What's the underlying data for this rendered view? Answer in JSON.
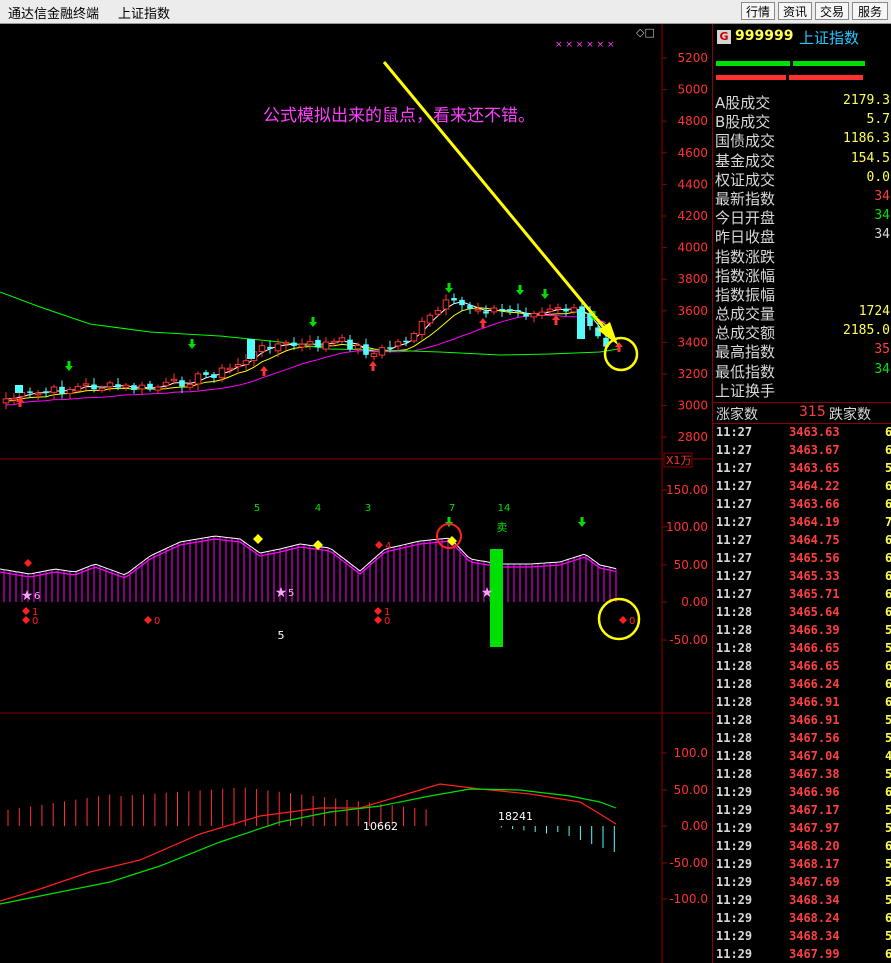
{
  "window": {
    "app_title": "通达信金融终端",
    "index_title": "上证指数"
  },
  "toolbar": [
    {
      "label": "行情"
    },
    {
      "label": "资讯"
    },
    {
      "label": "交易"
    },
    {
      "label": "服务"
    }
  ],
  "annotation": {
    "text": "公式模拟出来的鼠点，看来还不错。"
  },
  "colors": {
    "background": "#000000",
    "up": "#ff3232",
    "down": "#54fcfc",
    "ma_fast": "#ffffff",
    "ma_mid": "#ffff00",
    "ma_slow": "#ff00ff",
    "ma_long": "#00ff00",
    "arrow": "#ffff00",
    "grid": "#8b0000"
  },
  "main_chart": {
    "price_axis": [
      "5200",
      "5000",
      "4800",
      "4600",
      "4400",
      "4200",
      "4000",
      "3800",
      "3600",
      "3400",
      "3200",
      "3000",
      "2800"
    ],
    "corner_glyphs": "◇□",
    "stars": "× × × × × ×"
  },
  "indicator1": {
    "multiplier_tag": "X1万",
    "axis": [
      "150.00",
      "100.00",
      "50.00",
      "0.00",
      "-50.00"
    ],
    "top_numbers": [
      "5",
      "4",
      "3",
      "7",
      "14"
    ],
    "sell_label": "卖",
    "star_labels": [
      "6",
      "5"
    ],
    "diamond_labels": [
      "1",
      "0",
      "0",
      "4",
      "1",
      "0",
      "0"
    ],
    "bottom_number": "5"
  },
  "indicator2": {
    "axis": [
      "100.0",
      "50.00",
      "0.00",
      "-50.00",
      "-100.0"
    ],
    "labels": [
      "10662",
      "18241"
    ]
  },
  "quote": {
    "logo": "G",
    "code": "999999",
    "name": "上证指数",
    "stats": [
      {
        "label": "A股成交",
        "value": "2179.3",
        "color": "y"
      },
      {
        "label": "B股成交",
        "value": "5.7",
        "color": "y"
      },
      {
        "label": "国债成交",
        "value": "1186.3",
        "color": "y"
      },
      {
        "label": "基金成交",
        "value": "154.5",
        "color": "y"
      },
      {
        "label": "权证成交",
        "value": "0.0",
        "color": "y"
      },
      {
        "label": "最新指数",
        "value": "34",
        "color": "r"
      },
      {
        "label": "今日开盘",
        "value": "34",
        "color": "g"
      },
      {
        "label": "昨日收盘",
        "value": "34",
        "color": "w"
      },
      {
        "label": "指数涨跌",
        "value": "",
        "color": "y"
      },
      {
        "label": "指数涨幅",
        "value": "",
        "color": "y"
      },
      {
        "label": "指数振幅",
        "value": "",
        "color": "y"
      },
      {
        "label": "总成交量",
        "value": "1724",
        "color": "y"
      },
      {
        "label": "总成交额",
        "value": "2185.0",
        "color": "y"
      },
      {
        "label": "最高指数",
        "value": "35",
        "color": "r"
      },
      {
        "label": "最低指数",
        "value": "34",
        "color": "g"
      },
      {
        "label": "上证换手",
        "value": "",
        "color": "y"
      }
    ],
    "up_count_label": "涨家数",
    "up_count": "315",
    "down_count_label": "跌家数",
    "ticks": [
      {
        "time": "11:27",
        "price": "3463.63",
        "vol": "6"
      },
      {
        "time": "11:27",
        "price": "3463.67",
        "vol": "6"
      },
      {
        "time": "11:27",
        "price": "3463.65",
        "vol": "5"
      },
      {
        "time": "11:27",
        "price": "3464.22",
        "vol": "6"
      },
      {
        "time": "11:27",
        "price": "3463.66",
        "vol": "6"
      },
      {
        "time": "11:27",
        "price": "3464.19",
        "vol": "7"
      },
      {
        "time": "11:27",
        "price": "3464.75",
        "vol": "6"
      },
      {
        "time": "11:27",
        "price": "3465.56",
        "vol": "6"
      },
      {
        "time": "11:27",
        "price": "3465.33",
        "vol": "6"
      },
      {
        "time": "11:27",
        "price": "3465.71",
        "vol": "6"
      },
      {
        "time": "11:28",
        "price": "3465.64",
        "vol": "6"
      },
      {
        "time": "11:28",
        "price": "3466.39",
        "vol": "5"
      },
      {
        "time": "11:28",
        "price": "3466.65",
        "vol": "5"
      },
      {
        "time": "11:28",
        "price": "3466.65",
        "vol": "6"
      },
      {
        "time": "11:28",
        "price": "3466.24",
        "vol": "6"
      },
      {
        "time": "11:28",
        "price": "3466.91",
        "vol": "6"
      },
      {
        "time": "11:28",
        "price": "3466.91",
        "vol": "5"
      },
      {
        "time": "11:28",
        "price": "3467.56",
        "vol": "5"
      },
      {
        "time": "11:28",
        "price": "3467.04",
        "vol": "4"
      },
      {
        "time": "11:28",
        "price": "3467.38",
        "vol": "5"
      },
      {
        "time": "11:29",
        "price": "3466.96",
        "vol": "6"
      },
      {
        "time": "11:29",
        "price": "3467.17",
        "vol": "5"
      },
      {
        "time": "11:29",
        "price": "3467.97",
        "vol": "5"
      },
      {
        "time": "11:29",
        "price": "3468.20",
        "vol": "6"
      },
      {
        "time": "11:29",
        "price": "3468.17",
        "vol": "5"
      },
      {
        "time": "11:29",
        "price": "3467.69",
        "vol": "5"
      },
      {
        "time": "11:29",
        "price": "3468.34",
        "vol": "5"
      },
      {
        "time": "11:29",
        "price": "3468.24",
        "vol": "6"
      },
      {
        "time": "11:29",
        "price": "3468.34",
        "vol": "5"
      },
      {
        "time": "11:29",
        "price": "3467.99",
        "vol": "6"
      }
    ]
  }
}
